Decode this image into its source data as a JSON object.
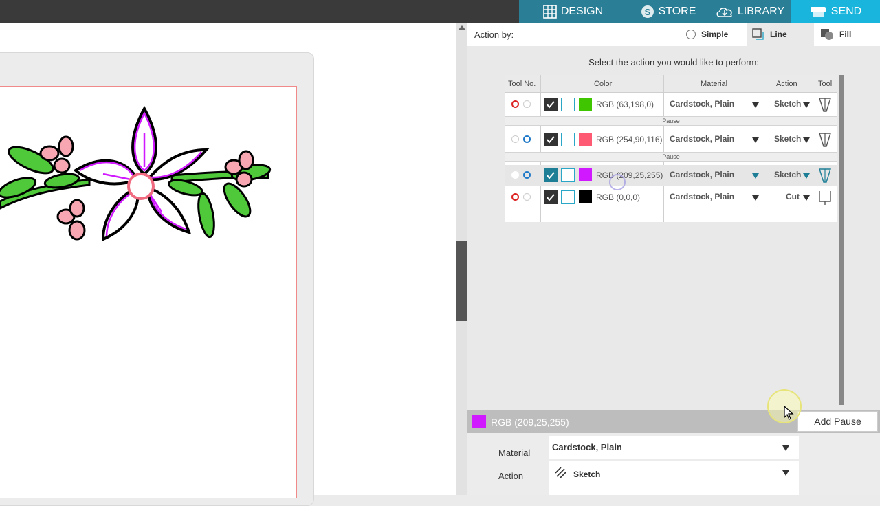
{
  "nav": {
    "design": "DESIGN",
    "store": "STORE",
    "library": "LIBRARY",
    "send": "SEND"
  },
  "action_by": {
    "label": "Action by:",
    "simple": "Simple",
    "line": "Line",
    "fill": "Fill",
    "selected": "Line"
  },
  "prompt": "Select the action you would like to perform:",
  "table": {
    "headers": [
      "Tool No.",
      "Color",
      "Material",
      "Action",
      "Tool"
    ],
    "pause_label": "Pause",
    "rows": [
      {
        "color_hex": "#3fc600",
        "rgb": "RGB (63,198,0)",
        "material": "Cardstock, Plain",
        "action": "Sketch",
        "tool_no": "red"
      },
      {
        "color_hex": "#fe5a74",
        "rgb": "RGB (254,90,116)",
        "material": "Cardstock, Plain",
        "action": "Sketch",
        "tool_no": "blue"
      },
      {
        "color_hex": "#d119ff",
        "rgb": "RGB (209,25,255)",
        "material": "Cardstock, Plain",
        "action": "Sketch",
        "tool_no": "blue",
        "selected": true
      },
      {
        "color_hex": "#000000",
        "rgb": "RGB (0,0,0)",
        "material": "Cardstock, Plain",
        "action": "Cut",
        "tool_no": "red"
      }
    ]
  },
  "selection": {
    "rgb": "RGB (209,25,255)",
    "color_hex": "#d119ff",
    "add_pause": "Add Pause"
  },
  "detail": {
    "material_label": "Material",
    "material_value": "Cardstock, Plain",
    "action_label": "Action",
    "action_value": "Sketch"
  },
  "colors": {
    "nav_bg": "#2a7f96",
    "nav_active": "#19b5dc",
    "topbar": "#3a3a3a",
    "selected_check": "#1d7e96"
  }
}
